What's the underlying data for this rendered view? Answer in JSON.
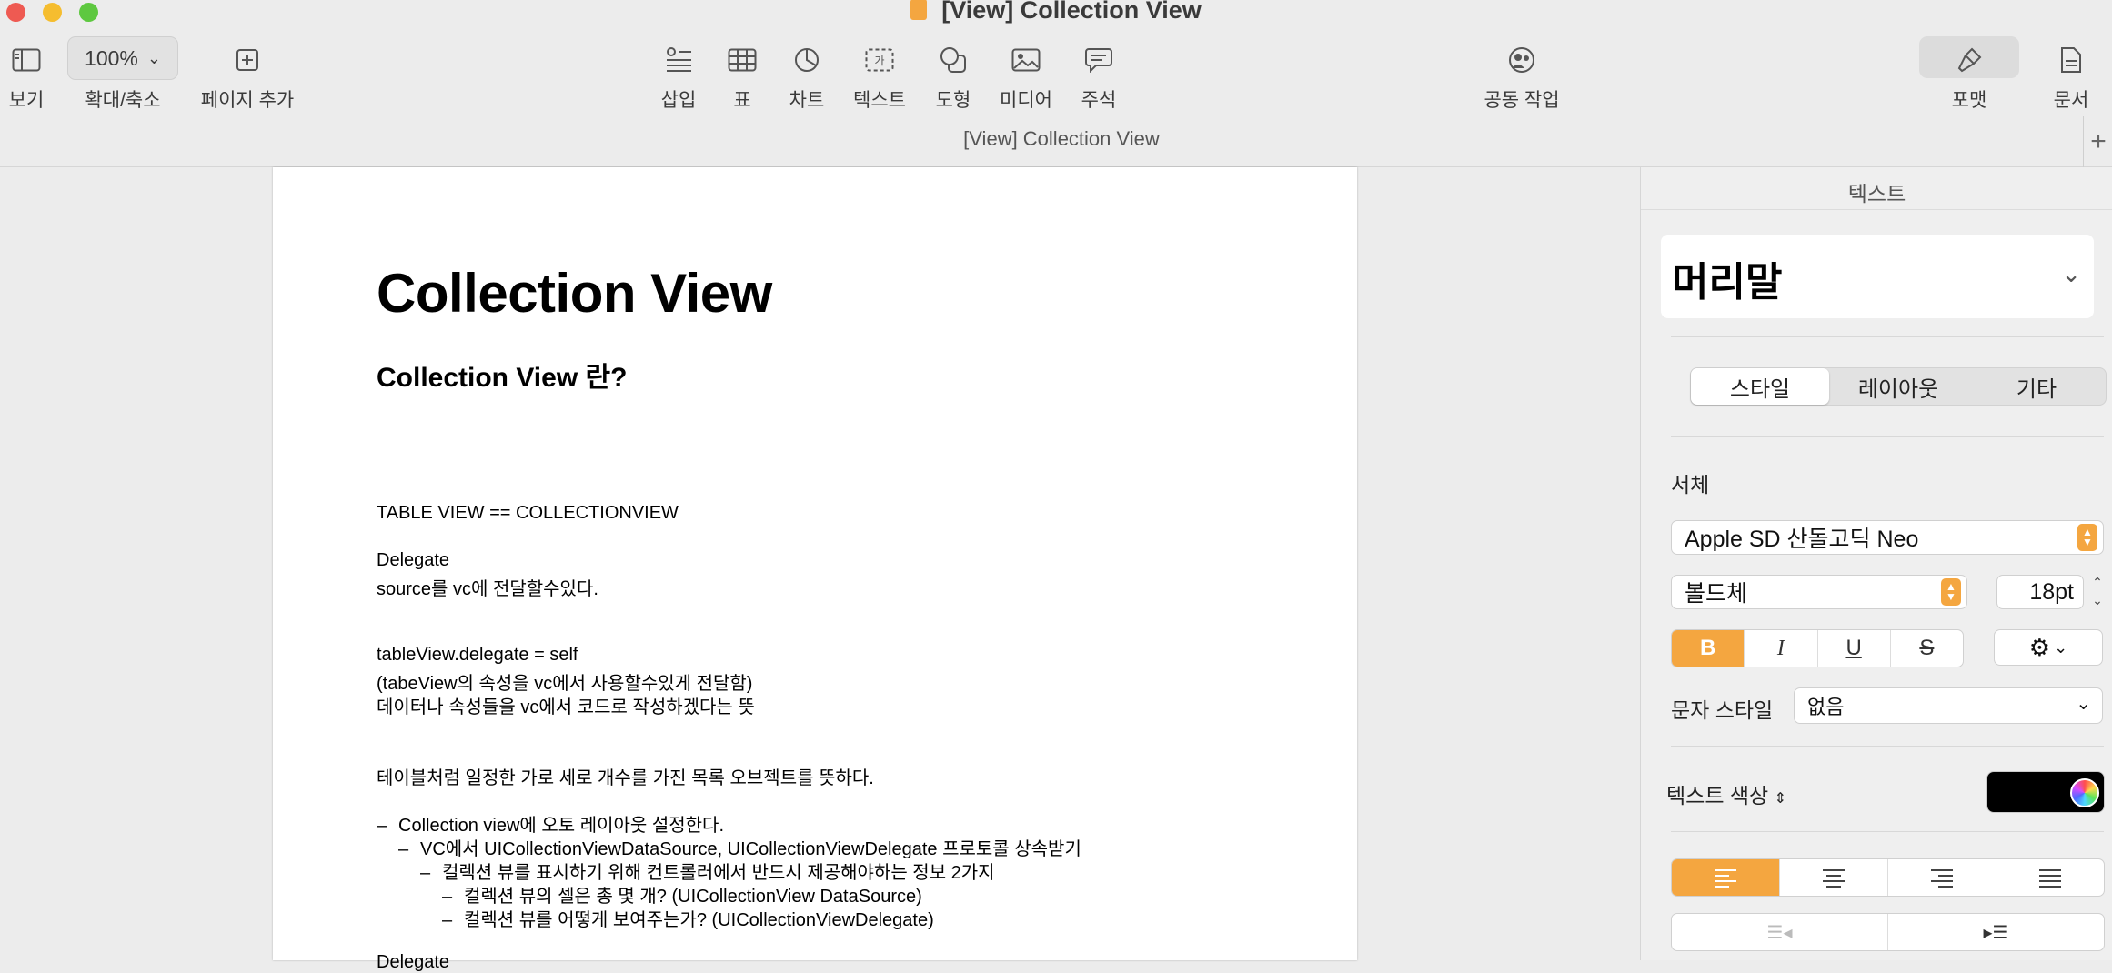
{
  "window": {
    "title": "[View] Collection View",
    "doc_tab_title": "[View] Collection View",
    "add_tab": "+"
  },
  "toolbar": {
    "view_label": "보기",
    "zoom_value": "100%",
    "zoom_label": "확대/축소",
    "add_page_label": "페이지 추가",
    "insert_label": "삽입",
    "table_label": "표",
    "chart_label": "차트",
    "text_label": "텍스트",
    "shape_label": "도형",
    "media_label": "미디어",
    "comment_label": "주석",
    "collaborate_label": "공동 작업",
    "format_label": "포맷",
    "document_label": "문서"
  },
  "document": {
    "title": "Collection View",
    "subtitle": "Collection View 란?",
    "lines": [
      "TABLE VIEW == COLLECTIONVIEW",
      "Delegate",
      "source를 vc에 전달할수있다.",
      "tableView.delegate = self",
      "(tabeView의 속성을 vc에서 사용할수있게 전달함)",
      "데이터나 속성들을 vc에서 코드로 작성하겠다는 뜻",
      "테이블처럼 일정한 가로 세로 개수를 가진 목록 오브젝트를 뜻하다.",
      "Collection view에 오토 레이아웃 설정한다.",
      "VC에서 UICollectionViewDataSource, UICollectionViewDelegate 프로토콜 상속받기",
      "컬렉션 뷰를 표시하기 위해 컨트롤러에서 반드시 제공해야하는 정보 2가지",
      "컬렉션 뷰의 셀은 총 몇 개? (UICollectionView DataSource)",
      "컬렉션 뷰를 어떻게 보여주는가? (UICollectionViewDelegate)",
      "Delegate"
    ]
  },
  "sidebar": {
    "title": "텍스트",
    "paragraph_style": "머리말",
    "tabs": [
      "스타일",
      "레이아웃",
      "기타"
    ],
    "font_section": "서체",
    "font_family": "Apple SD 산돌고딕 Neo",
    "font_weight": "볼드체",
    "font_size": "18pt",
    "format_buttons": [
      "B",
      "I",
      "U",
      "S"
    ],
    "char_style_label": "문자 스타일",
    "char_style_value": "없음",
    "text_color_label": "텍스트 색상",
    "text_color": "#000000",
    "accent": "#f4a640"
  }
}
